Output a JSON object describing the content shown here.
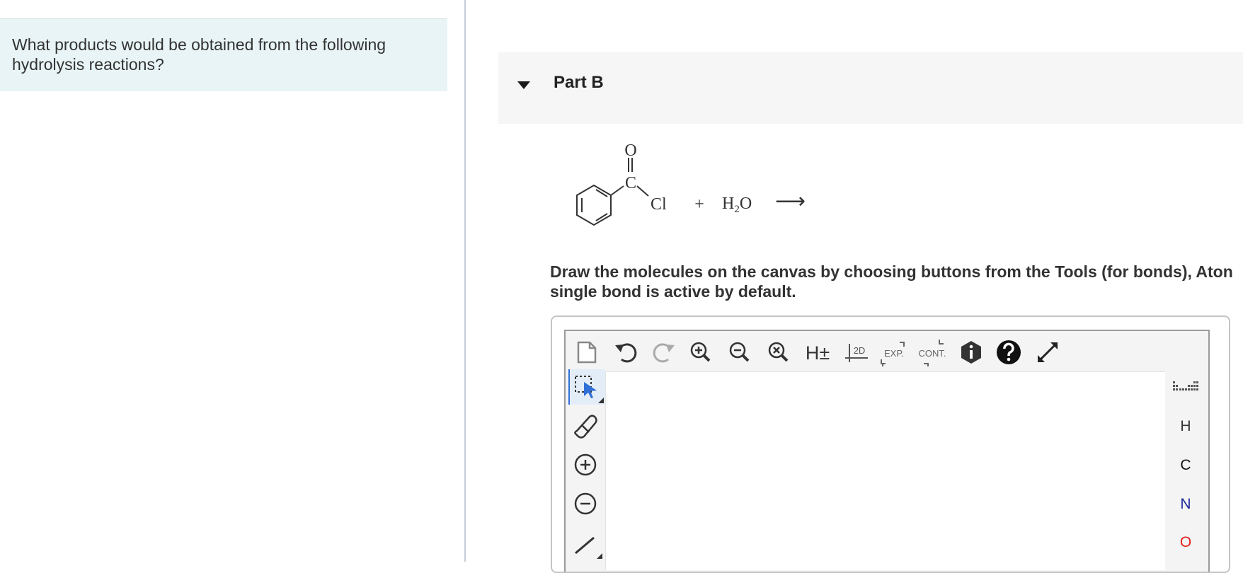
{
  "question": {
    "text": "What products would be obtained from the following hydrolysis reactions?"
  },
  "part": {
    "title": "Part B",
    "toggle_icon": "caret-down-icon"
  },
  "reaction": {
    "carbonyl_o": "O",
    "carbonyl_c": "C",
    "chlorine": "Cl",
    "plus": "+",
    "water_h": "H",
    "water_sub": "2",
    "water_o": "O",
    "arrow": "⟶"
  },
  "instructions": {
    "line1": "Draw the molecules on the canvas by choosing buttons from the Tools (for bonds), Aton",
    "line2": "single bond is active by default."
  },
  "toolbar": {
    "icons": [
      "new-document-icon",
      "undo-icon",
      "redo-icon",
      "zoom-in-icon",
      "zoom-out-icon",
      "zoom-reset-icon",
      "explicit-hydrogens-icon",
      "clean-2d-icon",
      "expand-group-icon",
      "contract-group-icon",
      "info-icon",
      "help-icon",
      "fullscreen-icon"
    ],
    "h_label": "H±",
    "clean_label": "2D",
    "exp_label": "EXP.",
    "cont_label": "CONT."
  },
  "left_tools": {
    "icons": [
      "selection-tool-icon",
      "eraser-icon",
      "positive-charge-icon",
      "negative-charge-icon",
      "single-bond-icon"
    ]
  },
  "atoms": {
    "periodic_table_icon": "periodic-table-icon",
    "items": [
      {
        "symbol": "H",
        "color": "#333333"
      },
      {
        "symbol": "C",
        "color": "#111111"
      },
      {
        "symbol": "N",
        "color": "#1f2a9a"
      },
      {
        "symbol": "O",
        "color": "#e0211c"
      }
    ]
  },
  "colors": {
    "question_bg": "#e8f4f5",
    "active_tool": "#2f6fd6"
  }
}
